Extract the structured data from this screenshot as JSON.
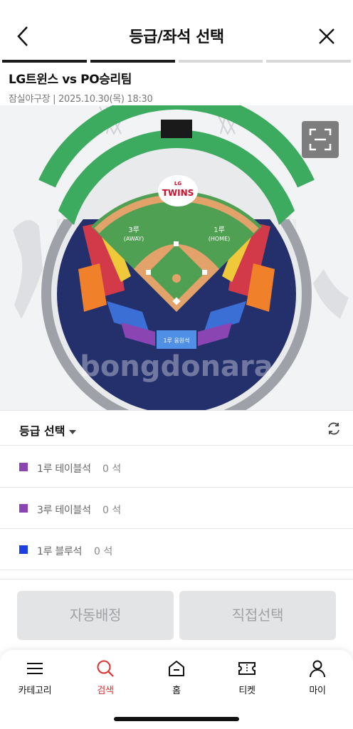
{
  "header": {
    "title": "등급/좌석 선택",
    "steps": 4,
    "active_steps": 2
  },
  "game": {
    "title": "LG트윈스 vs PO승리팀",
    "meta": "잠실야구장 | 2025.10.30(목) 18:30"
  },
  "stadium": {
    "logo_top": "LG",
    "logo_text": "TWINS",
    "third_base_label": "3루",
    "third_base_sub": "(AWAY)",
    "first_base_label": "1루",
    "first_base_sub": "(HOME)",
    "center_label": "1루 응원석",
    "watermark": "bongdonara",
    "colors": {
      "outfield_green": "#3caa5f",
      "navy": "#24306b",
      "red": "#d23a4a",
      "orange": "#f1802a",
      "blue": "#3b6fd6",
      "purple": "#8a45b3",
      "gray": "#8e939b",
      "grass": "#4fa052",
      "dirt": "#e3a26a",
      "logo_red": "#c8102e"
    }
  },
  "grade": {
    "label": "등급 선택",
    "items": [
      {
        "name": "1루 테이블석",
        "count": "0 석",
        "color": "#8a45b3"
      },
      {
        "name": "3루 테이블석",
        "count": "0 석",
        "color": "#8a45b3"
      },
      {
        "name": "1루 블루석",
        "count": "0 석",
        "color": "#1b3fe0"
      }
    ]
  },
  "actions": {
    "auto": "자동배정",
    "direct": "직접선택"
  },
  "nav": [
    {
      "label": "카테고리",
      "icon": "menu-icon"
    },
    {
      "label": "검색",
      "icon": "search-icon",
      "active": true
    },
    {
      "label": "홈",
      "icon": "home-icon"
    },
    {
      "label": "티켓",
      "icon": "ticket-icon"
    },
    {
      "label": "마이",
      "icon": "user-icon"
    }
  ]
}
